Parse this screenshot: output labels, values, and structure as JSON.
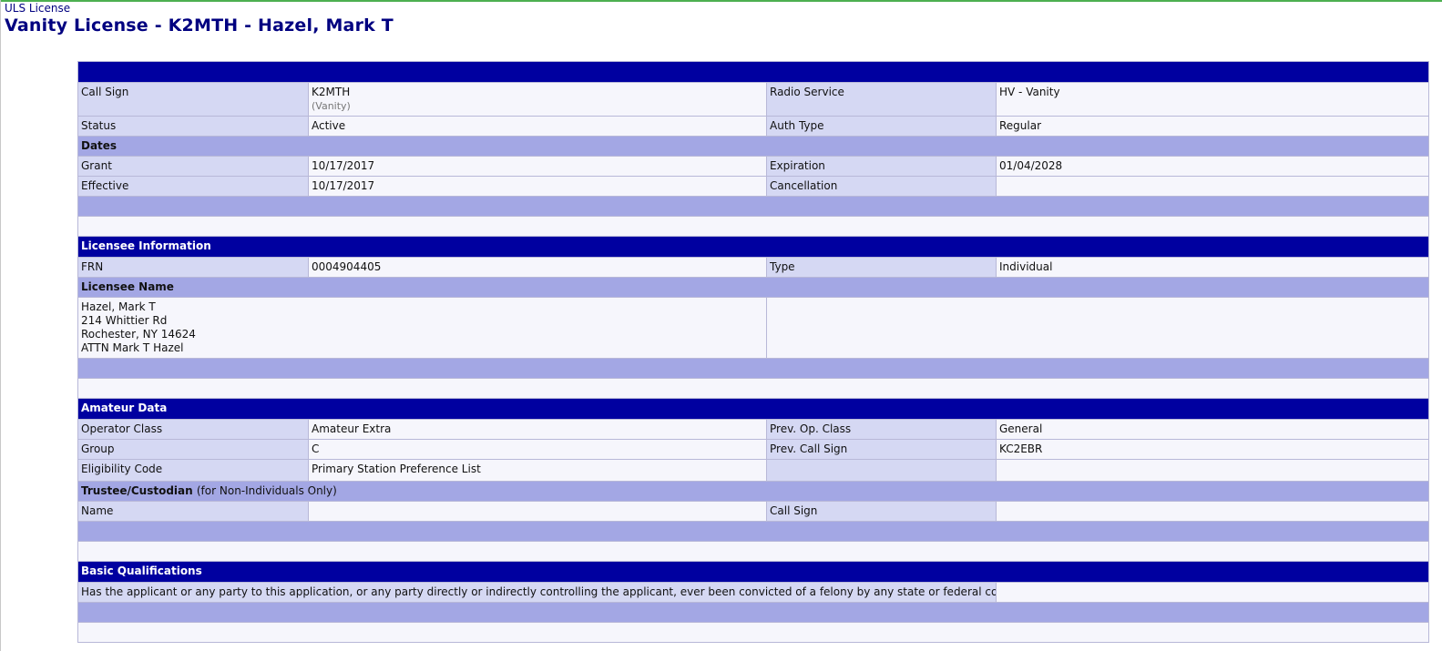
{
  "breadcrumb": "ULS License",
  "page_title": "Vanity License - K2MTH - Hazel, Mark T",
  "license": {
    "call_sign_label": "Call Sign",
    "call_sign": "K2MTH",
    "call_sign_note": "(Vanity)",
    "radio_service_label": "Radio Service",
    "radio_service": "HV - Vanity",
    "status_label": "Status",
    "status": "Active",
    "auth_type_label": "Auth Type",
    "auth_type": "Regular"
  },
  "dates": {
    "heading": "Dates",
    "grant_label": "Grant",
    "grant": "10/17/2017",
    "expiration_label": "Expiration",
    "expiration": "01/04/2028",
    "effective_label": "Effective",
    "effective": "10/17/2017",
    "cancellation_label": "Cancellation",
    "cancellation": ""
  },
  "licensee": {
    "heading": "Licensee Information",
    "frn_label": "FRN",
    "frn": "0004904405",
    "type_label": "Type",
    "type": "Individual",
    "name_heading": "Licensee Name",
    "address_lines": [
      "Hazel, Mark T",
      "214 Whittier Rd",
      "Rochester, NY 14624",
      "ATTN Mark T Hazel"
    ]
  },
  "amateur": {
    "heading": "Amateur Data",
    "operator_class_label": "Operator Class",
    "operator_class": "Amateur Extra",
    "prev_op_class_label": "Prev. Op. Class",
    "prev_op_class": "General",
    "group_label": "Group",
    "group": "C",
    "prev_call_sign_label": "Prev. Call Sign",
    "prev_call_sign": "KC2EBR",
    "eligibility_label": "Eligibility Code",
    "eligibility": "Primary Station Preference List",
    "trustee_heading": "Trustee/Custodian",
    "trustee_note": "(for Non-Individuals Only)",
    "name_label": "Name",
    "name": "",
    "trustee_call_sign_label": "Call Sign",
    "trustee_call_sign": ""
  },
  "qualifications": {
    "heading": "Basic Qualifications",
    "question": "Has the applicant or any party to this application, or any party directly or indirectly controlling the applicant, ever been convicted of a felony by any state or federal court?",
    "answer": ""
  },
  "colors": {
    "header_bg": "#0000a0",
    "subheader_bg": "#a3a7e4",
    "label_bg": "#d5d8f3",
    "value_bg": "#f6f6fc",
    "title_color": "#000080"
  }
}
